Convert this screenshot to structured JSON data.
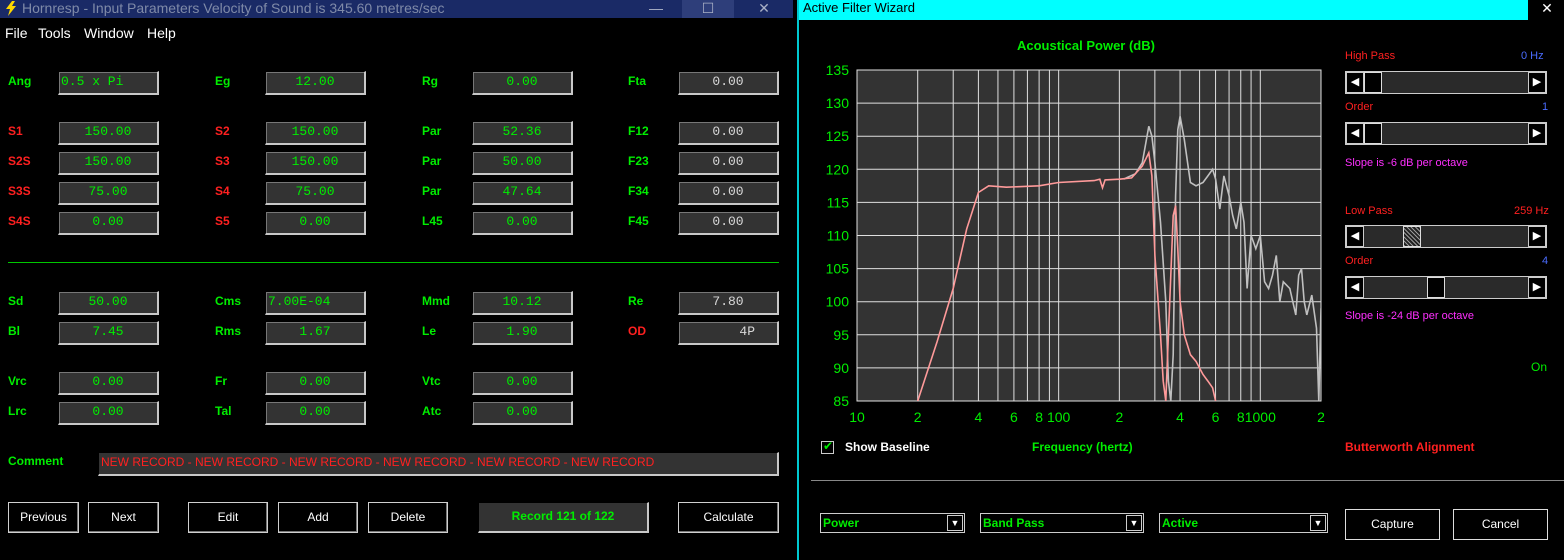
{
  "left_window": {
    "title": "Hornresp - Input Parameters   Velocity of Sound is 345.60 metres/sec",
    "controls": {
      "minimize": "—",
      "maximize": "☐",
      "close": "✕"
    },
    "menu": [
      "File",
      "Tools",
      "Window",
      "Help"
    ],
    "rows": [
      {
        "c1": {
          "label": "Ang",
          "value": "0.5 x Pi"
        },
        "c2": {
          "label": "Eg",
          "value": "12.00"
        },
        "c3": {
          "label": "Rg",
          "value": "0.00"
        },
        "c4": {
          "label": "Fta",
          "value": "0.00"
        }
      },
      {
        "c1": {
          "label": "S1",
          "value": "150.00"
        },
        "c2": {
          "label": "S2",
          "value": "150.00"
        },
        "c3": {
          "label": "Par",
          "value": "52.36"
        },
        "c4": {
          "label": "F12",
          "value": "0.00"
        }
      },
      {
        "c1": {
          "label": "S2S",
          "value": "150.00"
        },
        "c2": {
          "label": "S3",
          "value": "150.00"
        },
        "c3": {
          "label": "Par",
          "value": "50.00"
        },
        "c4": {
          "label": "F23",
          "value": "0.00"
        }
      },
      {
        "c1": {
          "label": "S3S",
          "value": "75.00"
        },
        "c2": {
          "label": "S4",
          "value": "75.00"
        },
        "c3": {
          "label": "Par",
          "value": "47.64"
        },
        "c4": {
          "label": "F34",
          "value": "0.00"
        }
      },
      {
        "c1": {
          "label": "S4S",
          "value": "0.00"
        },
        "c2": {
          "label": "S5",
          "value": "0.00"
        },
        "c3": {
          "label": "L45",
          "value": "0.00"
        },
        "c4": {
          "label": "F45",
          "value": "0.00"
        }
      },
      {
        "c1": {
          "label": "Sd",
          "value": "50.00"
        },
        "c2": {
          "label": "Cms",
          "value": "7.00E-04"
        },
        "c3": {
          "label": "Mmd",
          "value": "10.12"
        },
        "c4": {
          "label": "Re",
          "value": "7.80"
        }
      },
      {
        "c1": {
          "label": "Bl",
          "value": "7.45"
        },
        "c2": {
          "label": "Rms",
          "value": "1.67"
        },
        "c3": {
          "label": "Le",
          "value": "1.90"
        },
        "c4": {
          "label": "OD",
          "value": "4P"
        }
      },
      {
        "c1": {
          "label": "Vrc",
          "value": "0.00"
        },
        "c2": {
          "label": "Fr",
          "value": "0.00"
        },
        "c3": {
          "label": "Vtc",
          "value": "0.00"
        }
      },
      {
        "c1": {
          "label": "Lrc",
          "value": "0.00"
        },
        "c2": {
          "label": "Tal",
          "value": "0.00"
        },
        "c3": {
          "label": "Atc",
          "value": "0.00"
        }
      }
    ],
    "comment_label": "Comment",
    "comment_value": "NEW RECORD - NEW RECORD - NEW RECORD - NEW RECORD - NEW RECORD - NEW RECORD",
    "buttons": {
      "previous": "Previous",
      "next": "Next",
      "edit": "Edit",
      "add": "Add",
      "delete": "Delete",
      "calculate": "Calculate"
    },
    "record_status": "Record 121 of 122",
    "colors": {
      "label_green": "#00ee00",
      "label_red": "#ff2020",
      "field_bg": "#333333"
    }
  },
  "right_window": {
    "title": "Active Filter Wizard",
    "close": "✕",
    "show_baseline_label": "Show Baseline",
    "alignment_label": "Butterworth Alignment",
    "high_pass": {
      "label": "High Pass",
      "freq": "0 Hz",
      "order_label": "Order",
      "order": "1",
      "slope": "Slope is -6 dB per octave",
      "freq_slider_pos": 0.0,
      "order_slider_pos": 0.0
    },
    "low_pass": {
      "label": "Low Pass",
      "freq": "259 Hz",
      "order_label": "Order",
      "order": "4",
      "slope": "Slope is -24 dB per octave",
      "freq_slider_pos": 0.27,
      "order_slider_pos": 0.43
    },
    "status_on": "On",
    "dropdowns": [
      "Power",
      "Band Pass",
      "Active"
    ],
    "buttons": {
      "capture": "Capture",
      "cancel": "Cancel"
    },
    "colors": {
      "title_bar": "#00ffff",
      "plot_bg": "#333333",
      "grid": "#e0e0e0",
      "baseline": "#c0c0c0",
      "filtered": "#ff9a9a"
    }
  },
  "chart_data": {
    "type": "line",
    "title": "Acoustical Power (dB)",
    "xlabel": "Frequency (hertz)",
    "ylabel": "",
    "xscale": "log",
    "xlim": [
      10,
      2000
    ],
    "ylim": [
      85,
      135
    ],
    "y_ticks": [
      "135",
      "130",
      "125",
      "120",
      "115",
      "110",
      "105",
      "100",
      "95",
      "90",
      "85"
    ],
    "x_ticks": [
      {
        "v": 10,
        "t": "10"
      },
      {
        "v": 20,
        "t": "2"
      },
      {
        "v": 40,
        "t": "4"
      },
      {
        "v": 60,
        "t": "6"
      },
      {
        "v": 80,
        "t": "8"
      },
      {
        "v": 100,
        "t": "100"
      },
      {
        "v": 200,
        "t": "2"
      },
      {
        "v": 400,
        "t": "4"
      },
      {
        "v": 600,
        "t": "6"
      },
      {
        "v": 800,
        "t": "8"
      },
      {
        "v": 1000,
        "t": "1000"
      },
      {
        "v": 2000,
        "t": "2"
      }
    ],
    "grid": true,
    "series": [
      {
        "color": "#c0c0c0",
        "points": [
          [
            210,
            118.5
          ],
          [
            220,
            118.8
          ],
          [
            240,
            119.3
          ],
          [
            260,
            121
          ],
          [
            280,
            126.5
          ],
          [
            290,
            125
          ],
          [
            300,
            121
          ],
          [
            320,
            112
          ],
          [
            340,
            100
          ],
          [
            350,
            88
          ],
          [
            360,
            85
          ],
          [
            370,
            92
          ],
          [
            380,
            116
          ],
          [
            390,
            126
          ],
          [
            400,
            128
          ],
          [
            420,
            124.5
          ],
          [
            450,
            118
          ],
          [
            480,
            117.5
          ],
          [
            520,
            118
          ],
          [
            550,
            119
          ],
          [
            580,
            120
          ],
          [
            600,
            118.5
          ],
          [
            630,
            114
          ],
          [
            660,
            119
          ],
          [
            700,
            116
          ],
          [
            730,
            113
          ],
          [
            760,
            111
          ],
          [
            800,
            115
          ],
          [
            830,
            112
          ],
          [
            860,
            102
          ],
          [
            900,
            110
          ],
          [
            950,
            108
          ],
          [
            1000,
            110
          ],
          [
            1050,
            103
          ],
          [
            1100,
            102
          ],
          [
            1150,
            104
          ],
          [
            1200,
            107
          ],
          [
            1250,
            100
          ],
          [
            1300,
            103
          ],
          [
            1400,
            102
          ],
          [
            1500,
            98
          ],
          [
            1550,
            104
          ],
          [
            1600,
            105
          ],
          [
            1650,
            100
          ],
          [
            1700,
            98
          ],
          [
            1800,
            101
          ],
          [
            1900,
            96
          ],
          [
            1950,
            85
          ],
          [
            2000,
            99
          ]
        ]
      },
      {
        "color": "#ff9a9a",
        "points": [
          [
            20,
            85
          ],
          [
            25,
            94
          ],
          [
            30,
            102
          ],
          [
            35,
            111
          ],
          [
            40,
            116.5
          ],
          [
            45,
            117.5
          ],
          [
            55,
            117.3
          ],
          [
            80,
            117.5
          ],
          [
            100,
            118
          ],
          [
            150,
            118.3
          ],
          [
            160,
            118.5
          ],
          [
            165,
            117.2
          ],
          [
            170,
            118.4
          ],
          [
            200,
            118.5
          ],
          [
            230,
            118.7
          ],
          [
            260,
            120.5
          ],
          [
            280,
            122.5
          ],
          [
            290,
            119
          ],
          [
            300,
            107
          ],
          [
            320,
            95
          ],
          [
            330,
            88
          ],
          [
            340,
            85
          ],
          [
            350,
            95
          ],
          [
            360,
            104
          ],
          [
            370,
            113
          ],
          [
            380,
            114.5
          ],
          [
            390,
            108
          ],
          [
            400,
            100
          ],
          [
            420,
            95
          ],
          [
            450,
            92
          ],
          [
            480,
            91
          ],
          [
            520,
            89
          ],
          [
            550,
            88
          ],
          [
            580,
            87
          ],
          [
            600,
            85
          ]
        ]
      }
    ]
  }
}
